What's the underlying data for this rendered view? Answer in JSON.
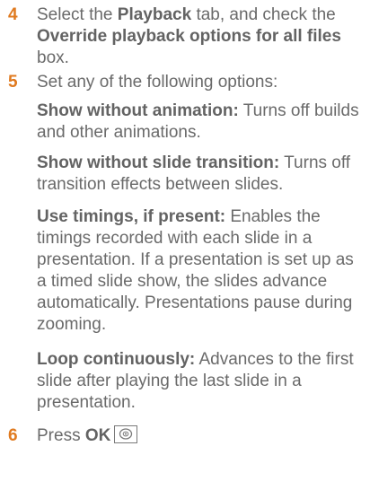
{
  "steps": [
    {
      "number": "4",
      "pre": "Select the ",
      "bold1": "Playback",
      "mid": " tab, and check the ",
      "bold2": "Override playback options for all files",
      "post": " box."
    },
    {
      "number": "5",
      "text": "Set any of the following options:"
    },
    {
      "number": "6",
      "pre": "Press ",
      "bold1": "OK",
      "key_icon": "ok-button-icon"
    }
  ],
  "options": [
    {
      "term": "Show without animation:",
      "desc": " Turns off builds and other animations."
    },
    {
      "term": "Show without slide transition:",
      "desc": " Turns off transition effects between slides."
    },
    {
      "term": "Use timings, if present:",
      "desc": " Enables the timings recorded with each slide in a presentation. If a presentation is set up as a timed slide show, the slides advance automatically. Presentations pause during zooming."
    },
    {
      "term": "Loop continuously:",
      "desc": " Advances to the first slide after playing the last slide in a presentation."
    }
  ],
  "colors": {
    "step_number": "#e07a1f",
    "body_text": "#6a6a6a"
  }
}
